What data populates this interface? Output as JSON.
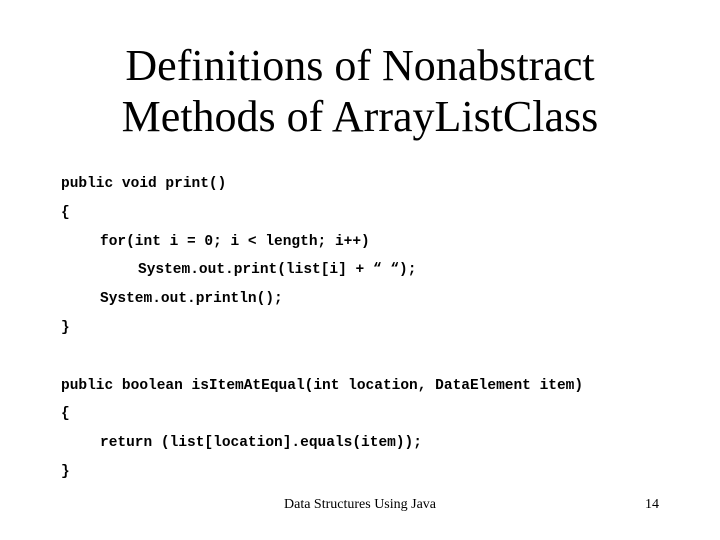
{
  "slide": {
    "title_lines": [
      "Definitions of Nonabstract",
      "Methods of ArrayListClass"
    ],
    "code_lines": [
      {
        "indent": 0,
        "text": "public void print()"
      },
      {
        "indent": 0,
        "text": "{"
      },
      {
        "indent": 1,
        "text": "for(int i = 0; i < length; i++)"
      },
      {
        "indent": 2,
        "text": "System.out.print(list[i] + “ “);"
      },
      {
        "indent": 1,
        "text": "System.out.println();"
      },
      {
        "indent": 0,
        "text": "}"
      },
      {
        "indent": 0,
        "text": ""
      },
      {
        "indent": 0,
        "text": "public boolean isItemAtEqual(int location, DataElement item)"
      },
      {
        "indent": 0,
        "text": "{"
      },
      {
        "indent": 1,
        "text": "return (list[location].equals(item));"
      },
      {
        "indent": 0,
        "text": "}"
      }
    ],
    "footer": {
      "text": "Data Structures Using Java",
      "page_number": "14"
    }
  }
}
